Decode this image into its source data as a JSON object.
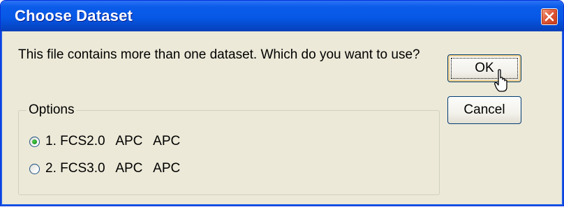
{
  "window": {
    "title": "Choose Dataset",
    "close_icon": "close-icon"
  },
  "message": "This file contains more than one dataset.  Which do you want to use?",
  "buttons": {
    "ok_label": "OK",
    "cancel_label": "Cancel"
  },
  "options_group": {
    "legend": "Options",
    "items": [
      {
        "label": "1. FCS2.0   APC   APC",
        "selected": true
      },
      {
        "label": "2. FCS3.0   APC   APC",
        "selected": false
      }
    ]
  },
  "colors": {
    "titlebar": "#0758e6",
    "window_bg": "#ece9d8",
    "close_button": "#e05a3a",
    "radio_selected": "#21a121"
  }
}
